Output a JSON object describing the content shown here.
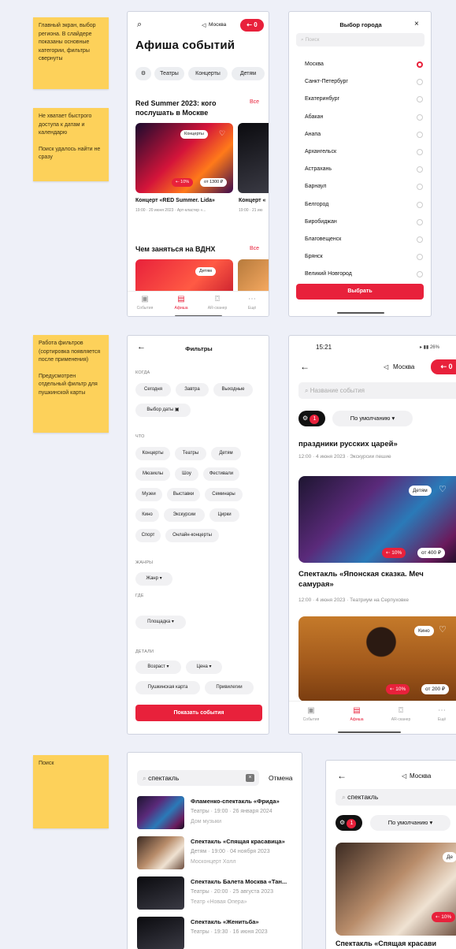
{
  "notes": {
    "n1": "Главный экран, выбор региона. В слайдере показаны основные категории, фильтры свернуты",
    "n2a": "Не хватает быстрого доступа к датам и календарю",
    "n2b": "Поиск удалось найти не сразу",
    "n3a": "Работа фильтров (сортировка появляется после применения)",
    "n3b": "Предусмотрен отдельный фильтр для пушкинской карты",
    "n4": "Поиск"
  },
  "home": {
    "city": "Москва",
    "badge": "0",
    "title": "Афиша событий",
    "categories": [
      "Театры",
      "Концерты",
      "Детям"
    ],
    "section1_title": "Red Summer 2023: кого послушать в Москве",
    "see_all": "Все",
    "card1": {
      "tag": "Концерты",
      "discount": "10%",
      "price": "от 1300 ₽",
      "title": "Концерт «RED Summer. Lida»",
      "meta": "19:00 · 20 июня 2023 · Арт-кластер «..."
    },
    "card2": {
      "title": "Концерт «",
      "meta": "19:00 · 21 ию"
    },
    "section2_title": "Чем заняться на ВДНХ",
    "see_all2": "Все",
    "card3": {
      "tag": "Детям"
    },
    "nav": [
      "События",
      "Афиша",
      "AR-сканер",
      "Ещё"
    ]
  },
  "city_picker": {
    "title": "Выбор города",
    "search_placeholder": "Поиск",
    "cities": [
      "Москва",
      "Санкт-Петербург",
      "Екатеринбург",
      "Абакан",
      "Анапа",
      "Архангельск",
      "Астрахань",
      "Барнаул",
      "Белгород",
      "Биробиджан",
      "Благовещенск",
      "Брянск",
      "Великий Новгород"
    ],
    "selected": "Москва",
    "button": "Выбрать"
  },
  "filters": {
    "title": "Фильтры",
    "when_label": "КОГДА",
    "when": [
      "Сегодня",
      "Завтра",
      "Выходные"
    ],
    "pick_date": "Выбор даты",
    "what_label": "ЧТО",
    "what_row1": [
      "Концерты",
      "Театры",
      "Детям"
    ],
    "what_row2": [
      "Мюзиклы",
      "Шоу",
      "Фестивали"
    ],
    "what_row3": [
      "Музеи",
      "Выставки",
      "Семинары"
    ],
    "what_row4": [
      "Кино",
      "Экскурсии",
      "Цирки"
    ],
    "what_row5": [
      "Спорт",
      "Онлайн-концерты"
    ],
    "genres_label": "ЖАНРЫ",
    "genre": "Жанр",
    "where_label": "ГДЕ",
    "venue": "Площадка",
    "details_label": "ДЕТАЛИ",
    "age": "Возраст",
    "price": "Цена",
    "pushkin": "Пушкинская карта",
    "privileges": "Привилегии",
    "apply": "Показать события"
  },
  "listing": {
    "time": "15:21",
    "status_right": "26%",
    "city": "Москва",
    "badge": "0",
    "search_placeholder": "Название события",
    "filter_count": "1",
    "sort": "По умолчанию",
    "prev_title": "праздники русских царей»",
    "prev_meta": "12:00 · 4 июня 2023 · Экскурсии пешие",
    "card1": {
      "tag": "Детям",
      "discount": "10%",
      "price": "от 400 ₽",
      "title": "Спектакль «Японская сказка. Меч самурая»",
      "meta": "12:00 · 4 июня 2023 · Театриум на Серпуховке"
    },
    "card2": {
      "tag": "Кино",
      "discount": "10%",
      "price": "от 200 ₽"
    },
    "nav": [
      "События",
      "Афиша",
      "AR-сканер",
      "Ещё"
    ]
  },
  "search": {
    "query": "спектакль",
    "cancel": "Отмена",
    "results": [
      {
        "title": "Фламенко-спектакль «Фрида»",
        "meta": "Театры · 19:00 · 26 января 2024",
        "venue": "Дом музыки"
      },
      {
        "title": "Спектакль «Спящая красавица»",
        "meta": "Детям · 19:00 · 04 ноября 2023",
        "venue": "Москонцерт Холл"
      },
      {
        "title": "Спектакль Балета Москва «Тан...",
        "meta": "Театры · 20:00 · 25 августа 2023",
        "venue": "Театр «Новая Опера»"
      },
      {
        "title": "Спектакль «Женитьба»",
        "meta": "Театры · 19:30 · 16 июня 2023",
        "venue": ""
      }
    ]
  },
  "search_results": {
    "city": "Москва",
    "query": "спектакль",
    "filter_count": "1",
    "sort": "По умолчанию",
    "tag": "Де",
    "discount": "10%",
    "title": "Спектакль «Спящая красави"
  }
}
